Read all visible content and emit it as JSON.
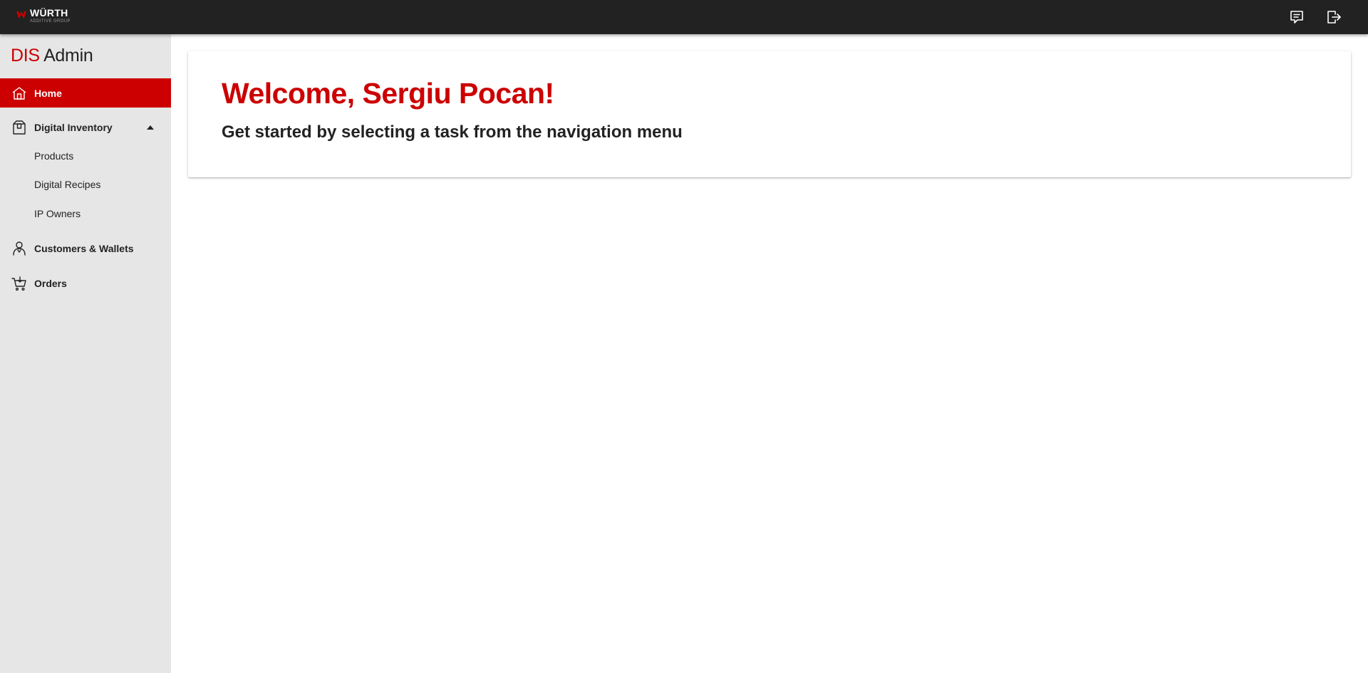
{
  "header": {
    "logo": {
      "name": "WÜRTH",
      "subtitle": "ADDITIVE GROUP"
    },
    "icons": [
      "feedback-icon",
      "logout-icon"
    ]
  },
  "sidebar": {
    "brand": {
      "part1": "DIS",
      "part2": "Admin"
    },
    "items": [
      {
        "label": "Home",
        "icon": "home-icon",
        "active": true
      },
      {
        "label": "Digital Inventory",
        "icon": "box-icon",
        "expanded": true,
        "children": [
          {
            "label": "Products"
          },
          {
            "label": "Digital Recipes"
          },
          {
            "label": "IP Owners"
          }
        ]
      },
      {
        "label": "Customers & Wallets",
        "icon": "user-icon"
      },
      {
        "label": "Orders",
        "icon": "cart-icon"
      }
    ]
  },
  "main": {
    "title": "Welcome, Sergiu Pocan!",
    "subtitle": "Get started by selecting a task from the navigation menu"
  },
  "colors": {
    "accent": "#cc0000",
    "topbar": "#222222",
    "sidebar": "#e6e6e6"
  }
}
